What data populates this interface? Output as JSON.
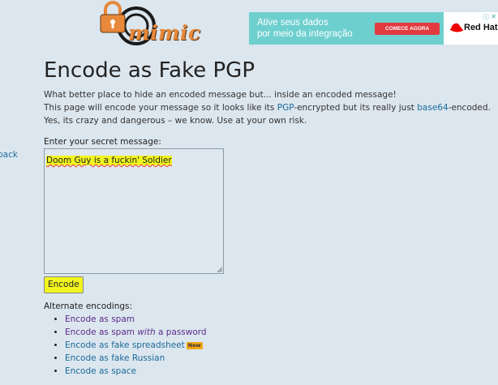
{
  "logo": {
    "text": "mimic",
    "icon": "padlock-logo-icon"
  },
  "ad": {
    "line1": "Ative seus dados",
    "line2": "por meio da integração",
    "button": "COMECE AGORA",
    "brand": "Red Hat",
    "info_icon": "info-icon",
    "close_icon": "close-icon"
  },
  "page": {
    "title": "Encode as Fake PGP",
    "intro1": "What better place to hide an encoded message but... inside an encoded message!",
    "intro2_a": "This page will encode your message so it looks like its ",
    "intro2_link1": "PGP",
    "intro2_b": "-encrypted but its really just ",
    "intro2_link2": "base64",
    "intro2_c": "-encoded.",
    "intro3": "Yes, its crazy and dangerous – we know. Use at your own risk.",
    "back": "back"
  },
  "form": {
    "label": "Enter your secret message:",
    "message": "Doom Guy is a fuckin' Soldier",
    "encode_button": "Encode"
  },
  "alternates": {
    "label": "Alternate encodings:",
    "items": [
      {
        "text": "Encode as spam"
      },
      {
        "pre": "Encode as spam ",
        "em": "with",
        "post": " a password"
      },
      {
        "text": "Encode as fake spreadsheet",
        "badge": "New"
      },
      {
        "text": "Encode as fake Russian"
      },
      {
        "text": "Encode as space"
      }
    ]
  },
  "colors": {
    "background": "#dce6ee",
    "highlight": "#f1f51e",
    "link_blue": "#1a6a9a",
    "link_purple": "#5b2b8a",
    "logo_orange": "#e8883a"
  }
}
